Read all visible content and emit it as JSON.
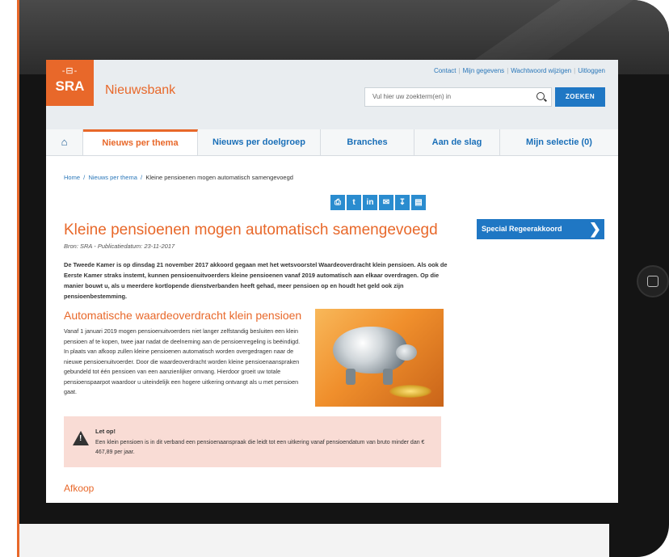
{
  "header": {
    "logo_glyph": "-⊟-",
    "logo_text": "SRA",
    "site_name": "Nieuwsbank",
    "links": [
      "Contact",
      "Mijn gegevens",
      "Wachtwoord wijzigen",
      "Uitloggen"
    ],
    "search_placeholder": "Vul hier uw zoekterm(en) in",
    "search_button": "ZOEKEN"
  },
  "nav": {
    "home_icon": "home-icon",
    "items": [
      "Nieuws per thema",
      "Nieuws per doelgroep",
      "Branches",
      "Aan de slag",
      "Mijn selectie (0)"
    ],
    "active_index": 0
  },
  "breadcrumb": [
    "Home",
    "Nieuws per thema",
    "Kleine pensioenen mogen automatisch samengevoegd"
  ],
  "share_icons": [
    "print-icon",
    "twitter-icon",
    "linkedin-icon",
    "mail-icon",
    "download-icon",
    "briefcase-icon"
  ],
  "article": {
    "title": "Kleine pensioenen mogen automatisch samengevoegd",
    "meta": "Bron: SRA - Publicatiedatum: 23-11-2017",
    "intro": "De Tweede Kamer is op dinsdag 21 november 2017 akkoord gegaan met het wetsvoorstel Waardeoverdracht klein pensioen. Als ook de Eerste Kamer straks instemt, kunnen pensioenuitvoerders kleine pensioenen vanaf 2019 automatisch aan elkaar overdragen. Op die manier bouwt u, als u meerdere kortlopende dienstverbanden heeft gehad, meer pensioen op en houdt het geld ook zijn pensioenbestemming.",
    "section_heading": "Automatische waardeoverdracht klein pensioen",
    "section_text": "Vanaf 1 januari 2019 mogen pensioenuitvoerders niet langer zelfstandig besluiten een klein pensioen af te kopen, twee jaar nadat de deelneming aan de pensioenregeling is beëindigd. In plaats van afkoop zullen kleine pensioenen automatisch worden overgedragen naar de nieuwe pensioenuitvoerder. Door die waardeoverdracht worden kleine pensioenaanspraken gebundeld tot één pensioen van een aanzienlijker omvang. Hierdoor groeit uw totale pensioenspaarpot waardoor u uiteindelijk een hogere uitkering ontvangt als u met pensioen gaat.",
    "alert_heading": "Let op!",
    "alert_text": "Een klein pensioen is in dit verband een pensioenaanspraak die leidt tot een uitkering vanaf pensioendatum van bruto minder dan € 467,89 per jaar.",
    "next_heading": "Afkoop"
  },
  "sidebar": {
    "special_label": "Special Regeerakkoord"
  },
  "colors": {
    "brand_orange": "#e8682a",
    "link_blue": "#1f77c4",
    "alert_bg": "#f9dcd5"
  }
}
